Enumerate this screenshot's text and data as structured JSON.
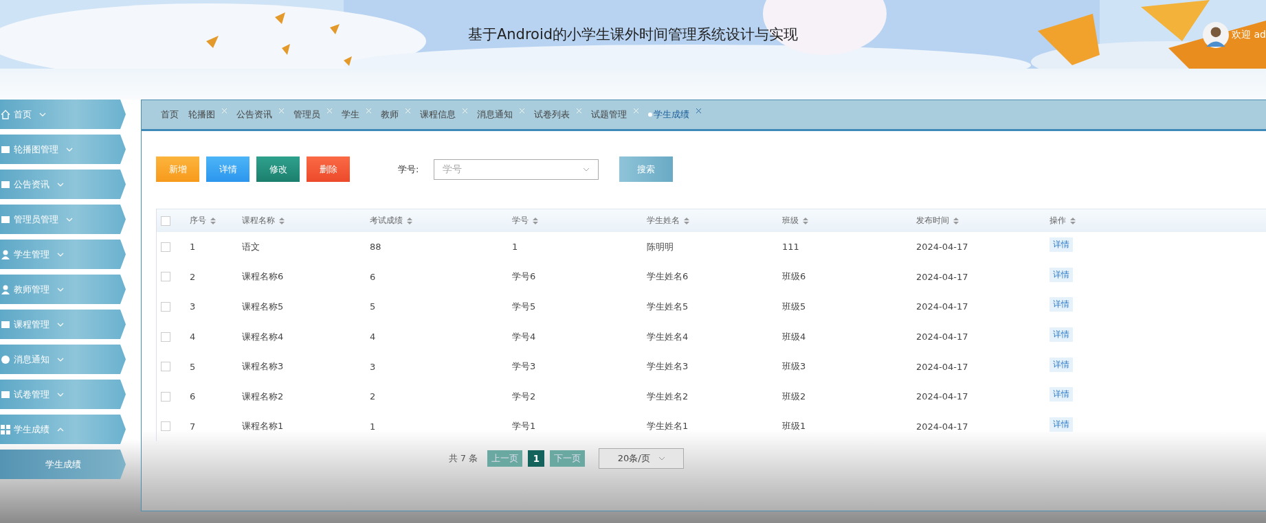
{
  "header": {
    "title": "基于Android的小学生课外时间管理系统设计与实现",
    "welcome": "欢迎 ad"
  },
  "menu": [
    {
      "label": "首页",
      "expanded": false
    },
    {
      "label": "轮播图管理",
      "expanded": false
    },
    {
      "label": "公告资讯",
      "expanded": false
    },
    {
      "label": "管理员管理",
      "expanded": false
    },
    {
      "label": "学生管理",
      "expanded": false
    },
    {
      "label": "教师管理",
      "expanded": false
    },
    {
      "label": "课程管理",
      "expanded": false
    },
    {
      "label": "消息通知",
      "expanded": false
    },
    {
      "label": "试卷管理",
      "expanded": false
    },
    {
      "label": "学生成绩",
      "expanded": true,
      "children": [
        {
          "label": "学生成绩"
        }
      ]
    }
  ],
  "tabs": [
    {
      "label": "首页",
      "closable": false,
      "selected": false
    },
    {
      "label": "轮播图",
      "closable": true,
      "selected": false
    },
    {
      "label": "公告资讯",
      "closable": true,
      "selected": false
    },
    {
      "label": "管理员",
      "closable": true,
      "selected": false
    },
    {
      "label": "学生",
      "closable": true,
      "selected": false
    },
    {
      "label": "教师",
      "closable": true,
      "selected": false
    },
    {
      "label": "课程信息",
      "closable": true,
      "selected": false
    },
    {
      "label": "消息通知",
      "closable": true,
      "selected": false
    },
    {
      "label": "试卷列表",
      "closable": true,
      "selected": false
    },
    {
      "label": "试题管理",
      "closable": true,
      "selected": false
    },
    {
      "label": "学生成绩",
      "closable": true,
      "selected": true
    }
  ],
  "toolbar": {
    "buttons": [
      {
        "label": "新增",
        "kind": "add"
      },
      {
        "label": "详情",
        "kind": "detail"
      },
      {
        "label": "修改",
        "kind": "edit"
      },
      {
        "label": "删除",
        "kind": "delete"
      }
    ],
    "search_label": "学号:",
    "search_placeholder": "学号",
    "search_button": "搜索"
  },
  "table": {
    "columns": [
      "序号",
      "课程名称",
      "考试成绩",
      "学号",
      "学生姓名",
      "班级",
      "发布时间",
      "操作"
    ],
    "header_checked": false,
    "rows": [
      {
        "checked": false,
        "cells": [
          "1",
          "语文",
          "88",
          "1",
          "陈明明",
          "111",
          "2024-04-17"
        ],
        "action": "详情"
      },
      {
        "checked": false,
        "cells": [
          "2",
          "课程名称6",
          "6",
          "学号6",
          "学生姓名6",
          "班级6",
          "2024-04-17"
        ],
        "action": "详情"
      },
      {
        "checked": false,
        "cells": [
          "3",
          "课程名称5",
          "5",
          "学号5",
          "学生姓名5",
          "班级5",
          "2024-04-17"
        ],
        "action": "详情"
      },
      {
        "checked": false,
        "cells": [
          "4",
          "课程名称4",
          "4",
          "学号4",
          "学生姓名4",
          "班级4",
          "2024-04-17"
        ],
        "action": "详情"
      },
      {
        "checked": false,
        "cells": [
          "5",
          "课程名称3",
          "3",
          "学号3",
          "学生姓名3",
          "班级3",
          "2024-04-17"
        ],
        "action": "详情"
      },
      {
        "checked": false,
        "cells": [
          "6",
          "课程名称2",
          "2",
          "学号2",
          "学生姓名2",
          "班级2",
          "2024-04-17"
        ],
        "action": "详情"
      },
      {
        "checked": false,
        "cells": [
          "7",
          "课程名称1",
          "1",
          "学号1",
          "学生姓名1",
          "班级1",
          "2024-04-17"
        ],
        "action": "详情"
      }
    ]
  },
  "pagination": {
    "total": "共 7 条",
    "prev": "上一页",
    "pages": [
      {
        "label": "1",
        "selected": true
      }
    ],
    "next": "下一页",
    "page_size": "20条/页"
  }
}
